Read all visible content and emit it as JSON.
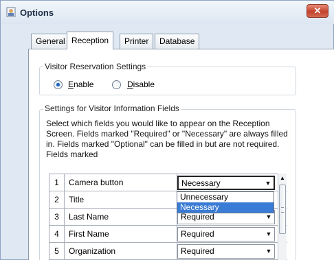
{
  "window": {
    "title": "Options",
    "close_glyph": "✕"
  },
  "tabs": [
    {
      "label": "General",
      "active": false
    },
    {
      "label": "Reception",
      "active": true
    },
    {
      "label": "Printer",
      "active": false
    },
    {
      "label": "Database",
      "active": false
    }
  ],
  "reservation": {
    "group_label": "Visitor Reservation Settings",
    "enable_label": "Enable",
    "disable_label": "Disable",
    "selected": "Enable"
  },
  "fields_settings": {
    "group_label": "Settings for Visitor Information Fields",
    "description": "Select which fields you would like to appear on the Reception Screen.  Fields marked \"Required\" or \"Necessary\" are always filled in.  Fields marked \"Optional\" can be filled in but are not required.  Fields marked"
  },
  "grid": {
    "rows": [
      {
        "num": "1",
        "name": "Camera button",
        "value": "Necessary"
      },
      {
        "num": "2",
        "name": "Title",
        "value": ""
      },
      {
        "num": "3",
        "name": "Last Name",
        "value": "Required"
      },
      {
        "num": "4",
        "name": "First Name",
        "value": "Required"
      },
      {
        "num": "5",
        "name": "Organization",
        "value": "Required"
      }
    ],
    "dropdown_options": [
      {
        "label": "Unnecessary",
        "selected": false
      },
      {
        "label": "Necessary",
        "selected": true
      }
    ]
  },
  "icons": {
    "app": "options-window-icon",
    "dropdown_arrow": "▼",
    "scroll_up": "▲"
  },
  "colors": {
    "selection": "#3a7bd5",
    "close_button": "#c2422d"
  }
}
